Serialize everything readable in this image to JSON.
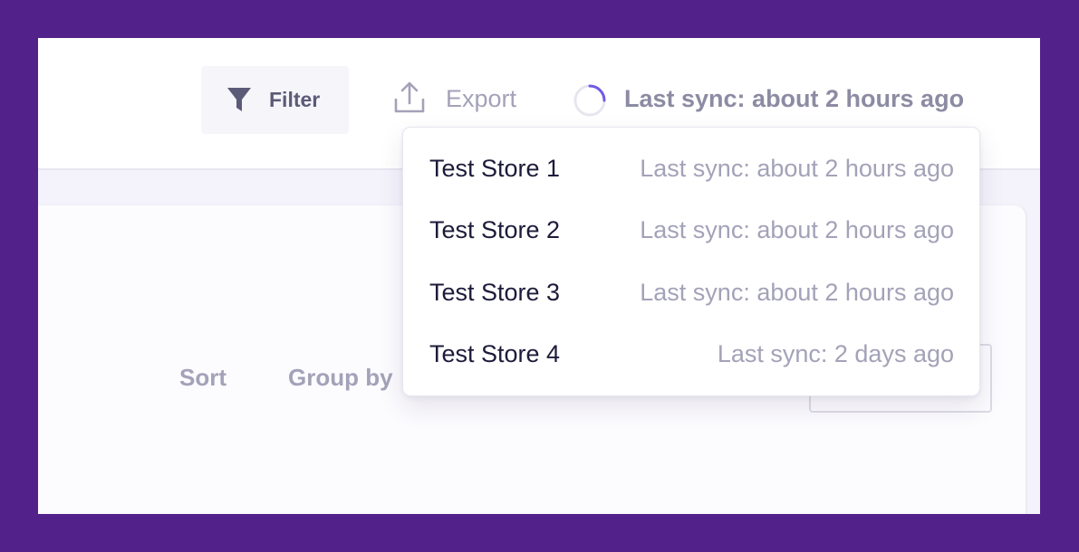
{
  "toolbar": {
    "filter_label": "Filter",
    "export_label": "Export",
    "sync_label": "Last sync: about 2 hours ago"
  },
  "view_controls": {
    "sort_label": "Sort",
    "group_by_label": "Group by"
  },
  "sync_dropdown": {
    "stores": [
      {
        "name": "Test Store 1",
        "last_sync": "Last sync: about 2 hours ago"
      },
      {
        "name": "Test Store 2",
        "last_sync": "Last sync: about 2 hours ago"
      },
      {
        "name": "Test Store 3",
        "last_sync": "Last sync: about 2 hours ago"
      },
      {
        "name": "Test Store 4",
        "last_sync": "Last sync: 2 days ago"
      }
    ]
  },
  "icons": {
    "filter": "filter-funnel-icon",
    "export": "upload-export-icon",
    "sync": "sync-spinner-icon"
  },
  "colors": {
    "frame_background": "#52218a",
    "spinner_accent": "#6f5be6",
    "primary_text": "#1d1b3a",
    "muted_text": "#a3a2b8"
  }
}
